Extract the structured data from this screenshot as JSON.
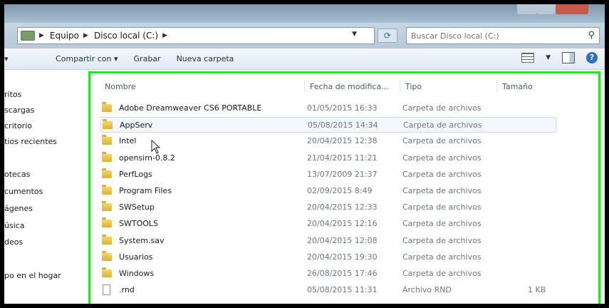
{
  "address": {
    "crumbs": [
      "Equipo",
      "Disco local (C:)"
    ],
    "search_placeholder": "Buscar Disco local (C:)"
  },
  "toolbar": {
    "organize_label": "",
    "share_label": "Compartir con ▾",
    "burn_label": "Grabar",
    "new_folder_label": "Nueva carpeta"
  },
  "nav": {
    "items": [
      "ritos",
      "scargas",
      "critorio",
      "tios recientes",
      "otecas",
      "cumentos",
      "ágenes",
      "úsica",
      "deos",
      "po en el hogar"
    ]
  },
  "columns": {
    "name": "Nombre",
    "date": "Fecha de modifica...",
    "type": "Tipo",
    "size": "Tamaño"
  },
  "files": [
    {
      "name": "Adobe Dreamweaver CS6 PORTABLE",
      "date": "01/05/2015 16:33",
      "type": "Carpeta de archivos",
      "size": "",
      "icon": "folder-icon"
    },
    {
      "name": "AppServ",
      "date": "05/08/2015 14:34",
      "type": "Carpeta de archivos",
      "size": "",
      "icon": "folder-icon"
    },
    {
      "name": "Intel",
      "date": "20/04/2015 12:38",
      "type": "Carpeta de archivos",
      "size": "",
      "icon": "folder-icon"
    },
    {
      "name": "opensim-0.8.2",
      "date": "21/04/2015 11:21",
      "type": "Carpeta de archivos",
      "size": "",
      "icon": "folder-icon"
    },
    {
      "name": "PerfLogs",
      "date": "13/07/2009 21:37",
      "type": "Carpeta de archivos",
      "size": "",
      "icon": "folder-icon"
    },
    {
      "name": "Program Files",
      "date": "02/09/2015 8:49",
      "type": "Carpeta de archivos",
      "size": "",
      "icon": "folder-icon"
    },
    {
      "name": "SWSetup",
      "date": "20/04/2015 12:33",
      "type": "Carpeta de archivos",
      "size": "",
      "icon": "folder-icon"
    },
    {
      "name": "SWTOOLS",
      "date": "20/04/2015 12:16",
      "type": "Carpeta de archivos",
      "size": "",
      "icon": "folder-icon"
    },
    {
      "name": "System.sav",
      "date": "20/04/2015 12:08",
      "type": "Carpeta de archivos",
      "size": "",
      "icon": "folder-icon"
    },
    {
      "name": "Usuarios",
      "date": "20/04/2015 19:30",
      "type": "Carpeta de archivos",
      "size": "",
      "icon": "folder-icon"
    },
    {
      "name": "Windows",
      "date": "26/08/2015 17:46",
      "type": "Carpeta de archivos",
      "size": "",
      "icon": "folder-icon"
    },
    {
      "name": ".rnd",
      "date": "05/08/2015 11:31",
      "type": "Archivo RND",
      "size": "1 KB",
      "icon": "file-icon"
    }
  ],
  "colors": {
    "highlight_border": "#2ee02c",
    "hover_row": "#f2f7fd"
  }
}
